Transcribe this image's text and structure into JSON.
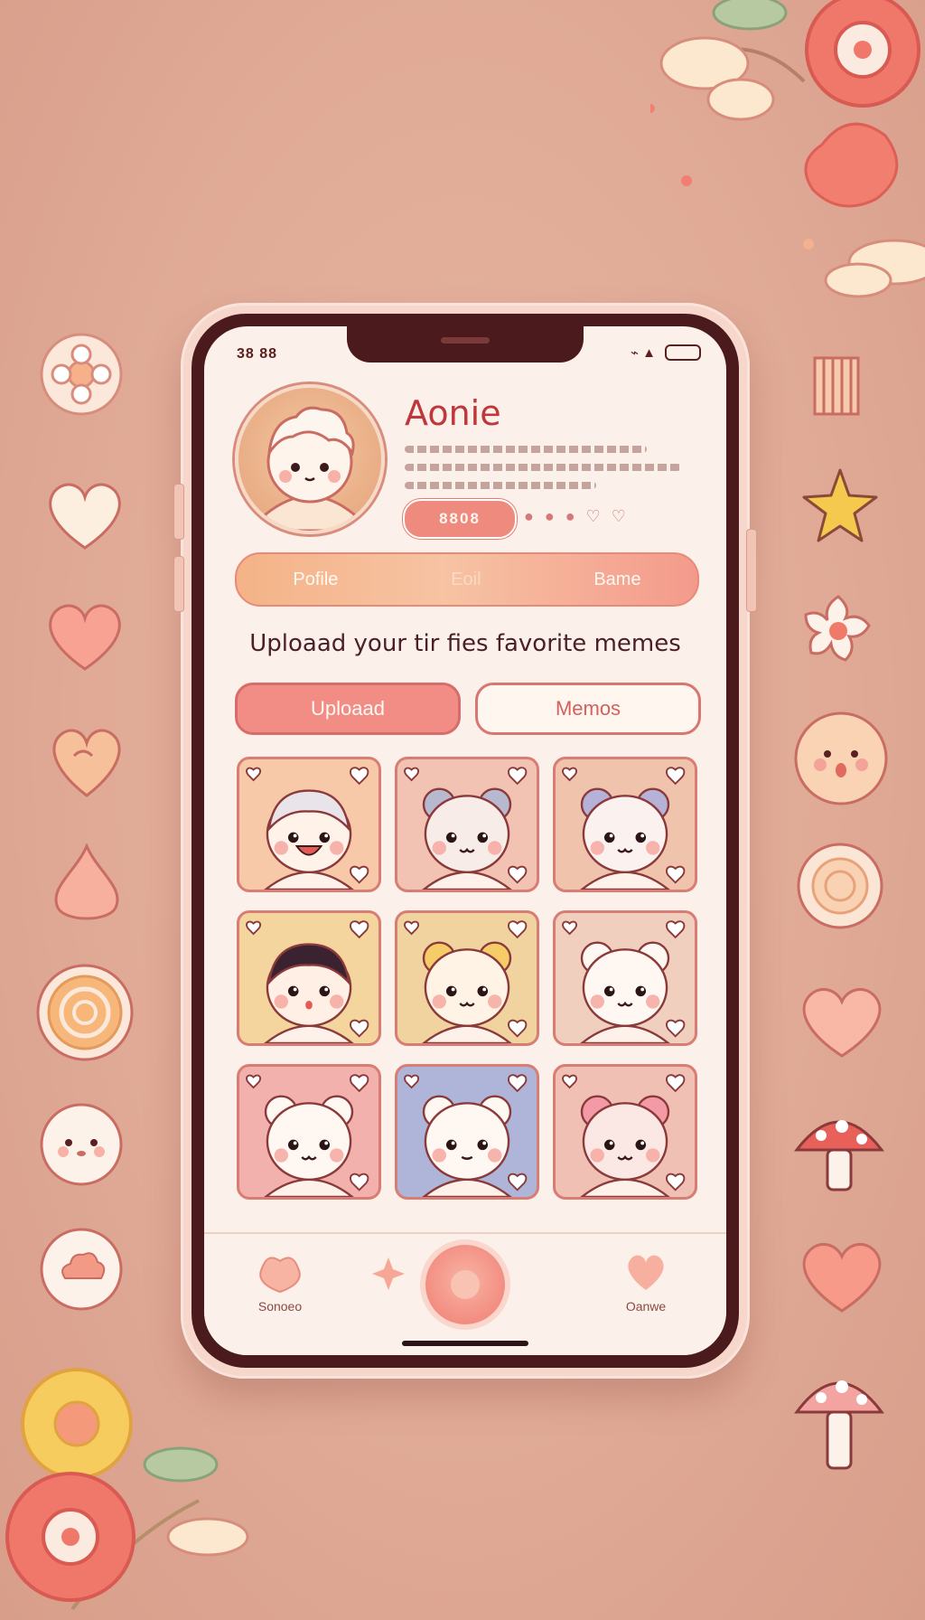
{
  "status_bar": {
    "time": "38 88",
    "icons": "⌁ ▲"
  },
  "profile": {
    "name": "Aonie",
    "follow_label": "8808",
    "mini_icons": [
      "●",
      "●",
      "●",
      "♡",
      "♡"
    ]
  },
  "tabs": [
    {
      "label": "Pofile"
    },
    {
      "label": "Eoil"
    },
    {
      "label": "Bame"
    }
  ],
  "headline": "Uploaad your tir fies favorite memes",
  "actions": {
    "upload_label": "Uploaad",
    "memos_label": "Memos"
  },
  "grid": [
    {
      "character": "laughing-kid",
      "bg": "#f7c9a8"
    },
    {
      "character": "grey-cat",
      "bg": "#f2c2b3"
    },
    {
      "character": "lavender-cat",
      "bg": "#f0c3ad"
    },
    {
      "character": "dark-hair-kid",
      "bg": "#f4d59d"
    },
    {
      "character": "yellow-dog",
      "bg": "#f0d39f"
    },
    {
      "character": "white-bear",
      "bg": "#f1cfbf"
    },
    {
      "character": "white-bear-2",
      "bg": "#f3b1ae"
    },
    {
      "character": "white-fox",
      "bg": "#aeb5d8"
    },
    {
      "character": "pink-pig",
      "bg": "#f0c0b4"
    }
  ],
  "bottom_nav": [
    {
      "label": "Sonoeo",
      "icon": "paw-icon"
    },
    {
      "label": "",
      "icon": "sparkle-icon"
    },
    {
      "label": "",
      "icon": "fab-icon"
    },
    {
      "label": "Oanwe",
      "icon": "heart-icon"
    }
  ],
  "colors": {
    "accent": "#f28d85",
    "name": "#c0373b",
    "frame": "#4a1a1c",
    "background": "#dfa995"
  }
}
